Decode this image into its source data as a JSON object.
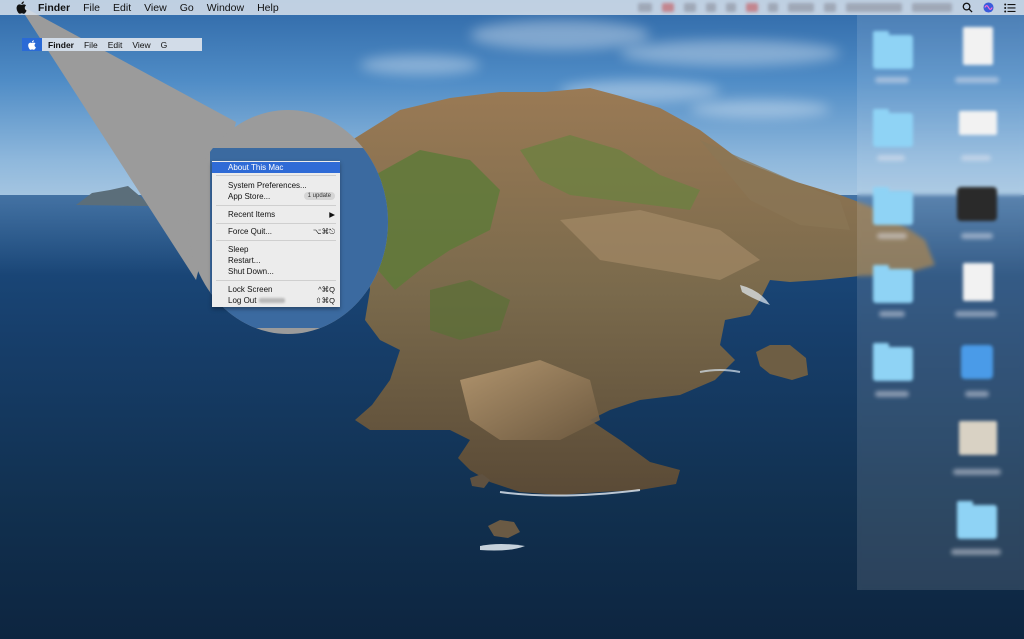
{
  "menubar": {
    "app_name": "Finder",
    "items": [
      "File",
      "Edit",
      "View",
      "Go",
      "Window",
      "Help"
    ],
    "icons": {
      "apple": "apple-icon",
      "search": "search-icon",
      "siri": "siri-icon",
      "control": "notification-center-icon"
    }
  },
  "magnifier": {
    "menubar": {
      "app_name": "Finder",
      "items": [
        "File",
        "Edit",
        "View",
        "G"
      ]
    },
    "apple_menu": {
      "items": [
        {
          "label": "About This Mac",
          "shortcut": "",
          "highlighted": true
        },
        {
          "label": "System Preferences...",
          "shortcut": ""
        },
        {
          "label": "App Store...",
          "badge": "1 update"
        },
        {
          "label": "Recent Items",
          "shortcut": "▶"
        },
        {
          "label": "Force Quit...",
          "shortcut": "⌥⌘⎋"
        },
        {
          "label": "Sleep",
          "shortcut": ""
        },
        {
          "label": "Restart...",
          "shortcut": ""
        },
        {
          "label": "Shut Down...",
          "shortcut": ""
        },
        {
          "label": "Lock Screen",
          "shortcut": "^⌘Q"
        },
        {
          "label": "Log Out",
          "shortcut": "⇧⌘Q"
        }
      ]
    }
  },
  "colors": {
    "menubar_bg": "#d7e1eb",
    "highlight": "#2f6bd6",
    "folder": "#8fd3f5",
    "magnifier_shadow": "#9b9b9b"
  }
}
